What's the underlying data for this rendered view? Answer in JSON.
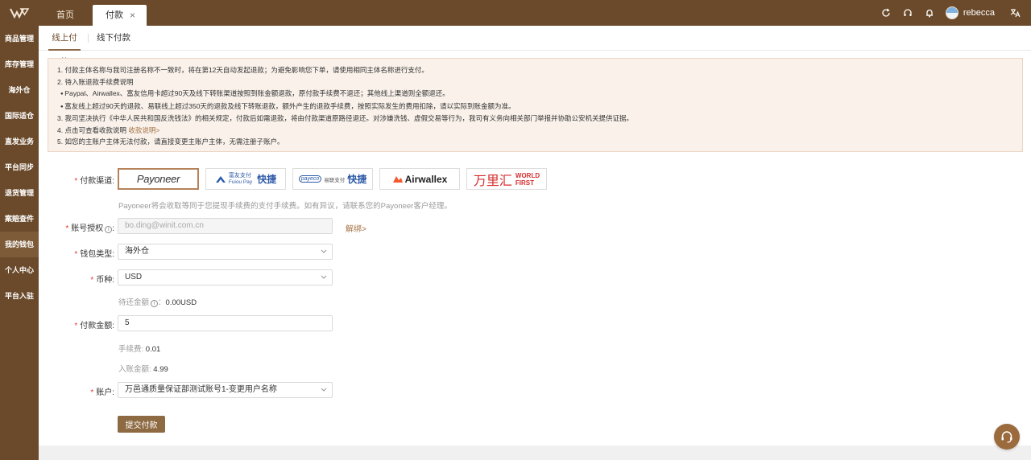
{
  "colors": {
    "brand": "#6b4a2b",
    "accent": "#8e6a43",
    "link": "#a57346",
    "required": "#e0402e"
  },
  "topbar": {
    "tabs": [
      {
        "label": "首页"
      },
      {
        "label": "付款"
      }
    ],
    "close_glyph": "×",
    "icons": [
      "refresh-icon",
      "headset-icon",
      "bell-icon",
      "translate-icon"
    ],
    "user": {
      "name": "rebecca"
    }
  },
  "sidebar": {
    "items": [
      {
        "label": "商品管理"
      },
      {
        "label": "库存管理"
      },
      {
        "label": "海外仓"
      },
      {
        "label": "国际适仓"
      },
      {
        "label": "直发业务"
      },
      {
        "label": "平台同步"
      },
      {
        "label": "退货管理"
      },
      {
        "label": "案赔查件"
      },
      {
        "label": "我的钱包"
      },
      {
        "label": "个人中心"
      },
      {
        "label": "平台入驻"
      }
    ]
  },
  "subtabs": {
    "online": "线上付款",
    "offline": "线下付款"
  },
  "notice": {
    "line1": "1. 付款主体名称与我司注册名称不一致时，将在第12天自动发起退款；为避免影响您下单，请使用相同主体名称进行支付。",
    "line2": "2. 待入账退款手续费说明",
    "line3": "Paypal、Airwallex、富友信用卡超过90天及线下转账渠道按照到账金额退款，原付款手续费不退还；其他线上渠道则全额退还。",
    "line4": "富友线上超过90天的退款、易联线上超过350天的退款及线下转账退款，额外产生的退款手续费，按照实际发生的费用扣除，请以实际到账金额为准。",
    "line5": "3. 我司坚决执行《中华人民共和国反洗钱法》的相关规定，付款后如需退款，将由付款渠道原路径退还。对涉嫌洗钱、虚假交易等行为，我司有义务向相关部门举报并协助公安机关提供证据。",
    "line6_prefix": "4. 点击可查看收款说明",
    "line6_link": "收款说明>",
    "line7": "5. 如您的主账户主体无法付款，请直接变更主账户主体，无需注册子账户。"
  },
  "form": {
    "channel_label": "付款渠道:",
    "channels": {
      "payoneer": "Payoneer",
      "fuiou_cn": "富友支付",
      "fuiou_en": "Fuiou Pay",
      "quick": "快捷",
      "payeco": "payeco",
      "payeco_cn": "易联支付",
      "airwallex": "Airwallex",
      "wanli": "万里汇",
      "world": "WORLD",
      "first": "FIRST"
    },
    "channel_hint": "Payoneer将会收取等同于您提现手续费的支付手续费。如有异议，请联系您的Payoneer客户经理。",
    "account_auth_label": "账号授权",
    "account_auth_value": "bo.ding@winit.com.cn",
    "unbind": "解绑>",
    "wallet_type_label": "钱包类型:",
    "wallet_type_value": "海外仓",
    "currency_label": "币种:",
    "currency_value": "USD",
    "pending_label": "待还金额",
    "pending_value": "0.00USD",
    "amount_label": "付款金额:",
    "amount_value": "5",
    "fee_label": "手续费:",
    "fee_value": "0.01",
    "credited_label": "入账金额:",
    "credited_value": "4.99",
    "account_label": "账户:",
    "account_value": "万邑通质量保证部测试账号1-变更用户名称",
    "submit": "提交付款",
    "colon": "："
  }
}
